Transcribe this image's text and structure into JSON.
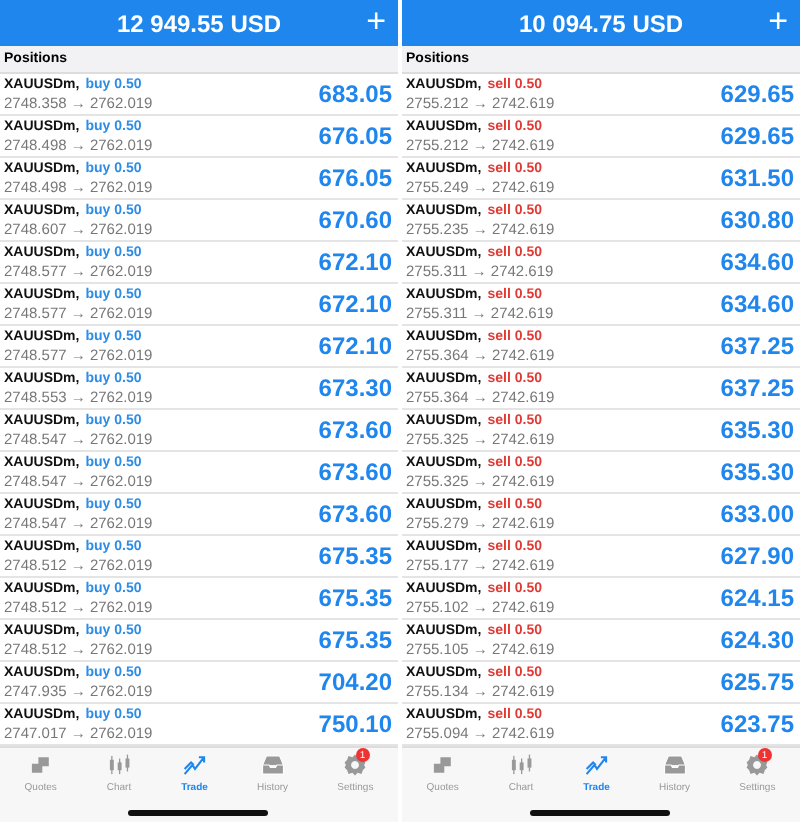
{
  "panels": [
    {
      "balance": "12 949.55 USD",
      "add": "+",
      "section": "Positions",
      "positions": [
        {
          "symbol": "XAUUSDm,",
          "order": "buy 0.50",
          "kind": "buy",
          "prices": "2748.358 → 2762.019",
          "profit": "683.05"
        },
        {
          "symbol": "XAUUSDm,",
          "order": "buy 0.50",
          "kind": "buy",
          "prices": "2748.498 → 2762.019",
          "profit": "676.05"
        },
        {
          "symbol": "XAUUSDm,",
          "order": "buy 0.50",
          "kind": "buy",
          "prices": "2748.498 → 2762.019",
          "profit": "676.05"
        },
        {
          "symbol": "XAUUSDm,",
          "order": "buy 0.50",
          "kind": "buy",
          "prices": "2748.607 → 2762.019",
          "profit": "670.60"
        },
        {
          "symbol": "XAUUSDm,",
          "order": "buy 0.50",
          "kind": "buy",
          "prices": "2748.577 → 2762.019",
          "profit": "672.10"
        },
        {
          "symbol": "XAUUSDm,",
          "order": "buy 0.50",
          "kind": "buy",
          "prices": "2748.577 → 2762.019",
          "profit": "672.10"
        },
        {
          "symbol": "XAUUSDm,",
          "order": "buy 0.50",
          "kind": "buy",
          "prices": "2748.577 → 2762.019",
          "profit": "672.10"
        },
        {
          "symbol": "XAUUSDm,",
          "order": "buy 0.50",
          "kind": "buy",
          "prices": "2748.553 → 2762.019",
          "profit": "673.30"
        },
        {
          "symbol": "XAUUSDm,",
          "order": "buy 0.50",
          "kind": "buy",
          "prices": "2748.547 → 2762.019",
          "profit": "673.60"
        },
        {
          "symbol": "XAUUSDm,",
          "order": "buy 0.50",
          "kind": "buy",
          "prices": "2748.547 → 2762.019",
          "profit": "673.60"
        },
        {
          "symbol": "XAUUSDm,",
          "order": "buy 0.50",
          "kind": "buy",
          "prices": "2748.547 → 2762.019",
          "profit": "673.60"
        },
        {
          "symbol": "XAUUSDm,",
          "order": "buy 0.50",
          "kind": "buy",
          "prices": "2748.512 → 2762.019",
          "profit": "675.35"
        },
        {
          "symbol": "XAUUSDm,",
          "order": "buy 0.50",
          "kind": "buy",
          "prices": "2748.512 → 2762.019",
          "profit": "675.35"
        },
        {
          "symbol": "XAUUSDm,",
          "order": "buy 0.50",
          "kind": "buy",
          "prices": "2748.512 → 2762.019",
          "profit": "675.35"
        },
        {
          "symbol": "XAUUSDm,",
          "order": "buy 0.50",
          "kind": "buy",
          "prices": "2747.935 → 2762.019",
          "profit": "704.20"
        },
        {
          "symbol": "XAUUSDm,",
          "order": "buy 0.50",
          "kind": "buy",
          "prices": "2747.017 → 2762.019",
          "profit": "750.10"
        }
      ],
      "tabs": [
        {
          "label": "Quotes",
          "selected": false
        },
        {
          "label": "Chart",
          "selected": false
        },
        {
          "label": "Trade",
          "selected": true
        },
        {
          "label": "History",
          "selected": false
        },
        {
          "label": "Settings",
          "selected": false,
          "badge": "1"
        }
      ]
    },
    {
      "balance": "10 094.75 USD",
      "add": "+",
      "section": "Positions",
      "positions": [
        {
          "symbol": "XAUUSDm,",
          "order": "sell 0.50",
          "kind": "sell",
          "prices": "2755.212 → 2742.619",
          "profit": "629.65"
        },
        {
          "symbol": "XAUUSDm,",
          "order": "sell 0.50",
          "kind": "sell",
          "prices": "2755.212 → 2742.619",
          "profit": "629.65"
        },
        {
          "symbol": "XAUUSDm,",
          "order": "sell 0.50",
          "kind": "sell",
          "prices": "2755.249 → 2742.619",
          "profit": "631.50"
        },
        {
          "symbol": "XAUUSDm,",
          "order": "sell 0.50",
          "kind": "sell",
          "prices": "2755.235 → 2742.619",
          "profit": "630.80"
        },
        {
          "symbol": "XAUUSDm,",
          "order": "sell 0.50",
          "kind": "sell",
          "prices": "2755.311 → 2742.619",
          "profit": "634.60"
        },
        {
          "symbol": "XAUUSDm,",
          "order": "sell 0.50",
          "kind": "sell",
          "prices": "2755.311 → 2742.619",
          "profit": "634.60"
        },
        {
          "symbol": "XAUUSDm,",
          "order": "sell 0.50",
          "kind": "sell",
          "prices": "2755.364 → 2742.619",
          "profit": "637.25"
        },
        {
          "symbol": "XAUUSDm,",
          "order": "sell 0.50",
          "kind": "sell",
          "prices": "2755.364 → 2742.619",
          "profit": "637.25"
        },
        {
          "symbol": "XAUUSDm,",
          "order": "sell 0.50",
          "kind": "sell",
          "prices": "2755.325 → 2742.619",
          "profit": "635.30"
        },
        {
          "symbol": "XAUUSDm,",
          "order": "sell 0.50",
          "kind": "sell",
          "prices": "2755.325 → 2742.619",
          "profit": "635.30"
        },
        {
          "symbol": "XAUUSDm,",
          "order": "sell 0.50",
          "kind": "sell",
          "prices": "2755.279 → 2742.619",
          "profit": "633.00"
        },
        {
          "symbol": "XAUUSDm,",
          "order": "sell 0.50",
          "kind": "sell",
          "prices": "2755.177 → 2742.619",
          "profit": "627.90"
        },
        {
          "symbol": "XAUUSDm,",
          "order": "sell 0.50",
          "kind": "sell",
          "prices": "2755.102 → 2742.619",
          "profit": "624.15"
        },
        {
          "symbol": "XAUUSDm,",
          "order": "sell 0.50",
          "kind": "sell",
          "prices": "2755.105 → 2742.619",
          "profit": "624.30"
        },
        {
          "symbol": "XAUUSDm,",
          "order": "sell 0.50",
          "kind": "sell",
          "prices": "2755.134 → 2742.619",
          "profit": "625.75"
        },
        {
          "symbol": "XAUUSDm,",
          "order": "sell 0.50",
          "kind": "sell",
          "prices": "2755.094 → 2742.619",
          "profit": "623.75"
        }
      ],
      "tabs": [
        {
          "label": "Quotes",
          "selected": false
        },
        {
          "label": "Chart",
          "selected": false
        },
        {
          "label": "Trade",
          "selected": true
        },
        {
          "label": "History",
          "selected": false
        },
        {
          "label": "Settings",
          "selected": false,
          "badge": "1"
        }
      ]
    }
  ]
}
